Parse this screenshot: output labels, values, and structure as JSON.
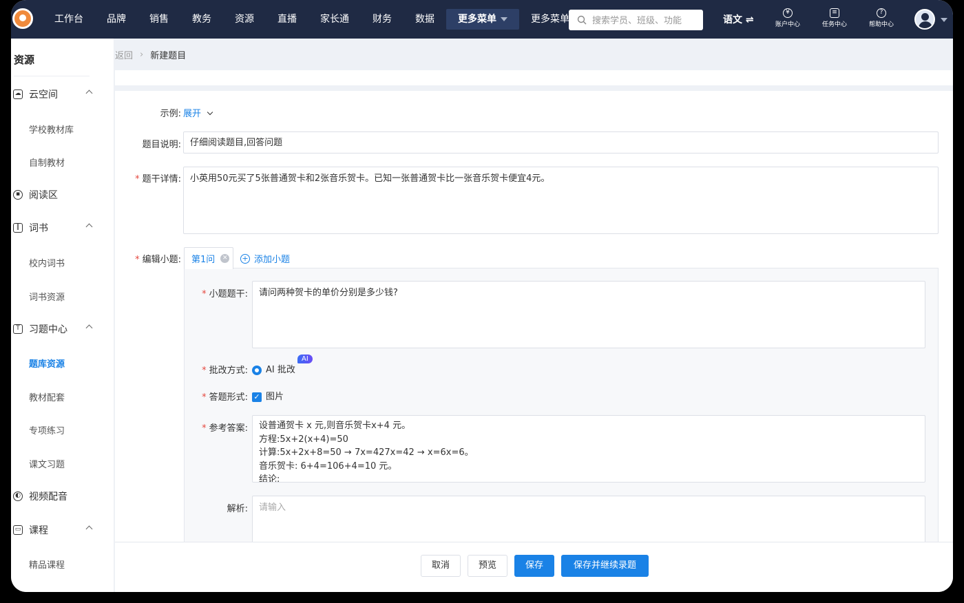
{
  "nav": {
    "items": [
      "工作台",
      "品牌",
      "销售",
      "教务",
      "资源",
      "直播",
      "家长通",
      "财务",
      "数据",
      "更多菜单",
      "更多菜单"
    ],
    "search_placeholder": "搜索学员、班级、功能",
    "language": "语文 ⇌",
    "account_center": "账户中心",
    "task_center": "任务中心",
    "help_center": "帮助中心"
  },
  "sidebar": {
    "title": "资源",
    "groups": [
      {
        "label": "云空间",
        "icon": "cloud-icon",
        "subs": [
          "学校教材库",
          "自制教材"
        ]
      },
      {
        "label": "阅读区",
        "icon": "grid-icon",
        "subs": []
      },
      {
        "label": "词书",
        "icon": "book-icon",
        "subs": [
          "校内词书",
          "词书资源"
        ]
      },
      {
        "label": "习题中心",
        "icon": "exercise-icon",
        "subs": [
          "题库资源",
          "教材配套",
          "专项练习",
          "课文习题"
        ]
      },
      {
        "label": "视频配音",
        "icon": "video-icon",
        "subs": []
      },
      {
        "label": "课程",
        "icon": "course-icon",
        "subs": [
          "精品课程"
        ]
      }
    ],
    "active_sub": "题库资源"
  },
  "breadcrumb": {
    "back": "返回",
    "current": "新建题目"
  },
  "form": {
    "example_label": "示例:",
    "example_toggle": "展开",
    "desc_label": "题目说明:",
    "desc_value": "仔细阅读题目,回答问题",
    "stem_label": "题干详情:",
    "stem_value": "小英用50元买了5张普通贺卡和2张音乐贺卡。已知一张普通贺卡比一张音乐贺卡便宜4元。",
    "edit_sub_label": "编辑小题:",
    "tab_label": "第1问",
    "add_sub": "添加小题",
    "sub_stem_label": "小题题干:",
    "sub_stem_value": "请问两种贺卡的单价分别是多少钱?",
    "grading_label": "批改方式:",
    "grading_value": "AI 批改",
    "ai_badge": "AI",
    "answer_form_label": "答题形式:",
    "answer_form_value": "图片",
    "ref_answer_label": "参考答案:",
    "ref_answer_lines": [
      "设普通贺卡 x 元,则音乐贺卡x+4 元。",
      "方程:5x+2(x+4)=50",
      "计算:5x+2x+8=50 → 7x=427x=42 → x=6x=6。",
      "音乐贺卡: 6+4=106+4=10 元。",
      "结论:"
    ],
    "analysis_label": "解析:",
    "analysis_placeholder": "请输入"
  },
  "footer": {
    "cancel": "取消",
    "preview": "预览",
    "save": "保存",
    "save_continue": "保存并继续录题"
  },
  "colors": {
    "nav_bg": "#1f2a44",
    "accent": "#1a82e6",
    "required": "#e5483f"
  }
}
